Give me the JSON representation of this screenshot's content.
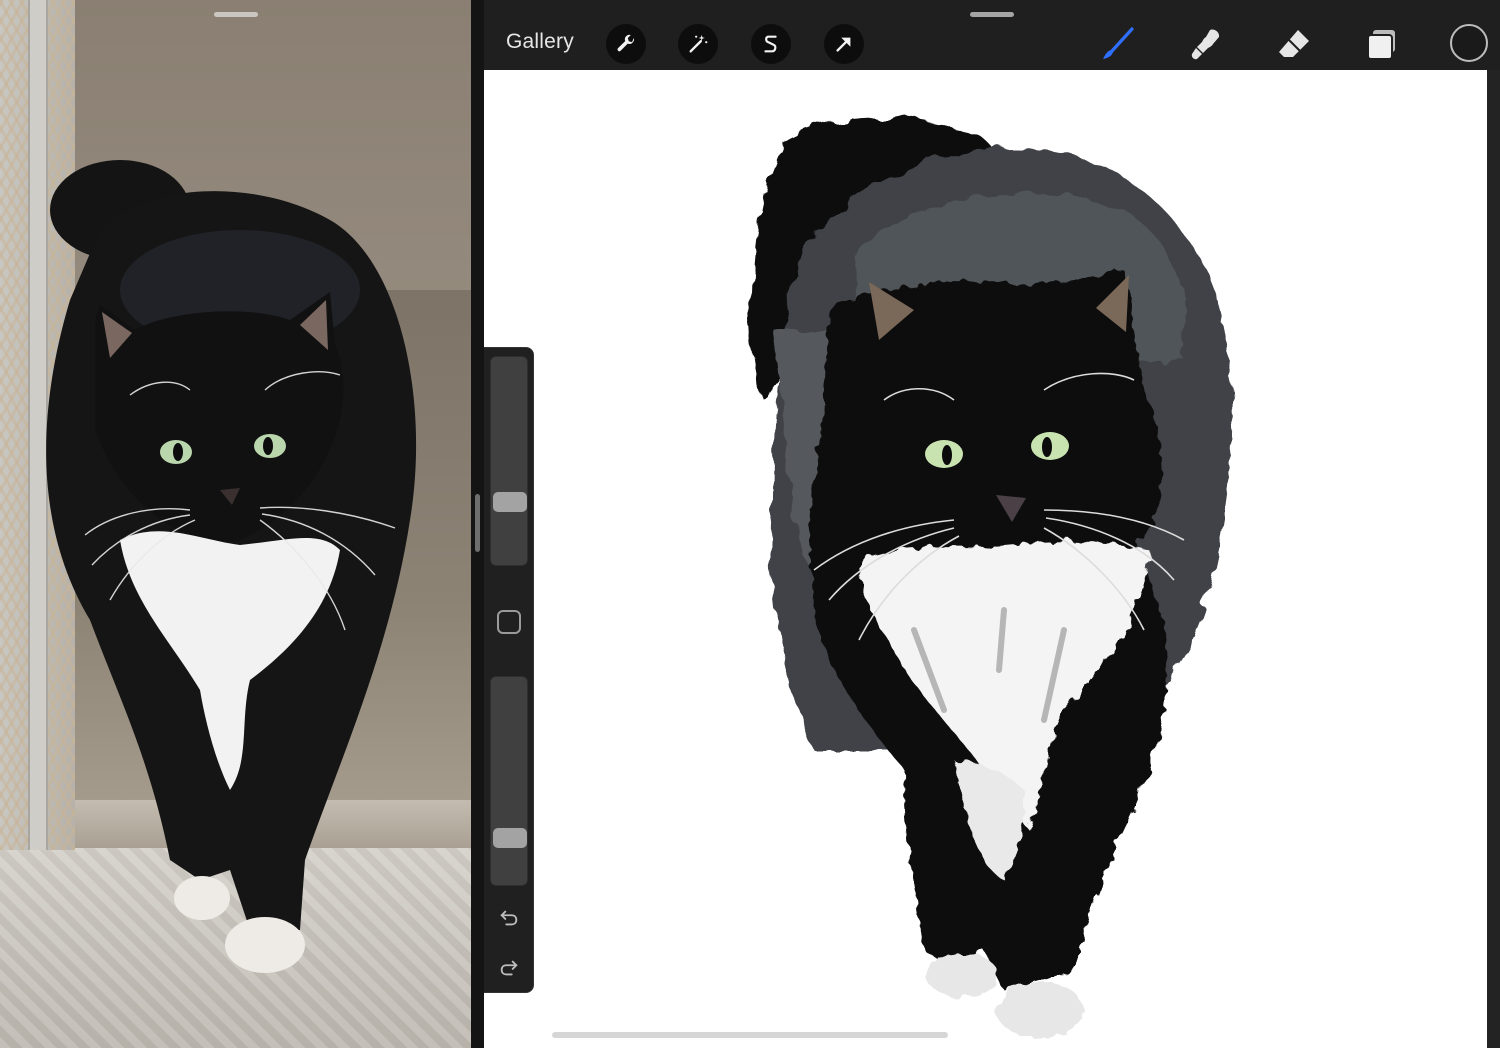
{
  "toolbar": {
    "gallery_label": "Gallery",
    "actions": [
      {
        "name": "actions-wrench-icon"
      },
      {
        "name": "adjustments-wand-icon"
      },
      {
        "name": "selection-s-icon"
      },
      {
        "name": "transform-arrow-icon"
      }
    ],
    "tools": [
      {
        "name": "brush-icon",
        "active": true,
        "color": "#2f6fff"
      },
      {
        "name": "smudge-icon",
        "active": false
      },
      {
        "name": "eraser-icon",
        "active": false
      },
      {
        "name": "layers-icon",
        "active": false
      }
    ],
    "current_color": "#1a1a1a"
  },
  "sidebar": {
    "brush_size_level": 0.28,
    "brush_opacity_level": 0.19
  },
  "colors": {
    "canvas": "#ffffff",
    "toolbar": "#1f1f1f",
    "accent": "#2f6fff",
    "cat_eyes": "#c9e3b0"
  }
}
